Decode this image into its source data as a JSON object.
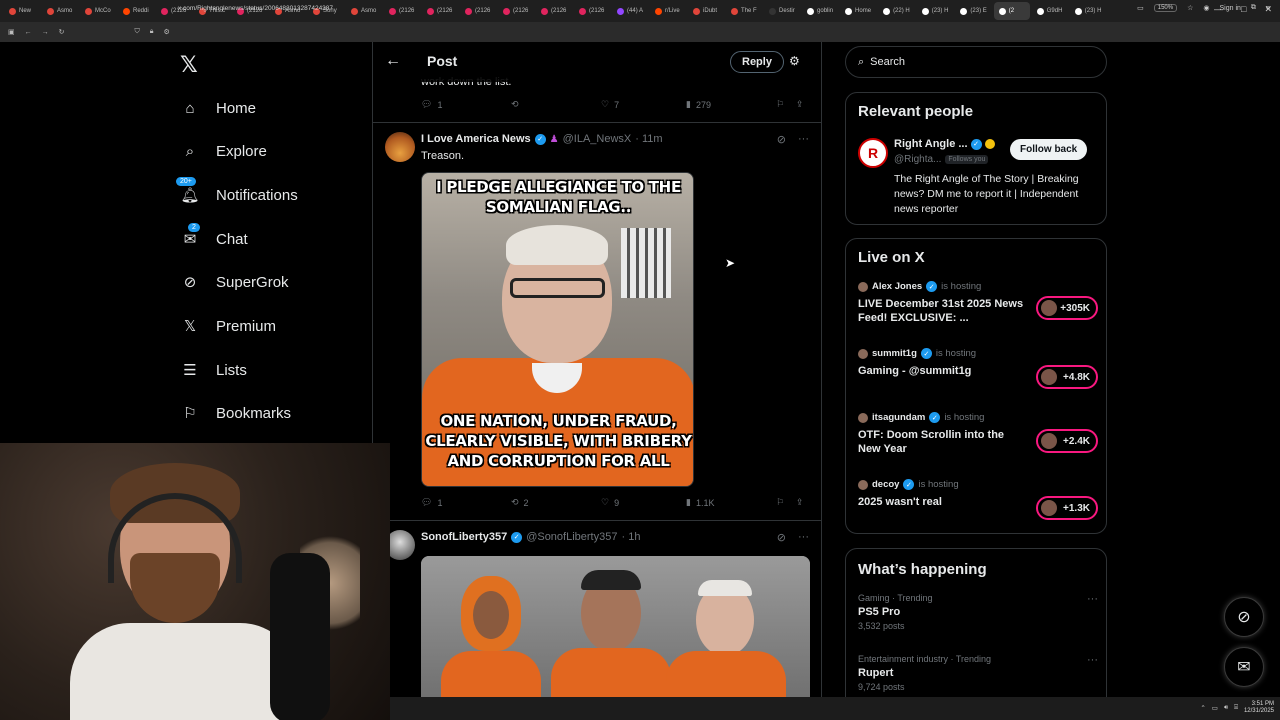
{
  "browser": {
    "tabs": [
      {
        "label": "New",
        "color": "#e0453a"
      },
      {
        "label": "Asmo",
        "color": "#e0453a"
      },
      {
        "label": "McCo",
        "color": "#e0453a"
      },
      {
        "label": "Reddi",
        "color": "#ff4500"
      },
      {
        "label": "(2126",
        "color": "#e0245e"
      },
      {
        "label": "This c",
        "color": "#e0453a"
      },
      {
        "label": "(2126",
        "color": "#e0245e"
      },
      {
        "label": "Asmo",
        "color": "#e0453a"
      },
      {
        "label": "Sony",
        "color": "#e0453a"
      },
      {
        "label": "Asmo",
        "color": "#e0453a"
      },
      {
        "label": "(2126",
        "color": "#e0245e"
      },
      {
        "label": "(2126",
        "color": "#e0245e"
      },
      {
        "label": "(2126",
        "color": "#e0245e"
      },
      {
        "label": "(2126",
        "color": "#e0245e"
      },
      {
        "label": "(2126",
        "color": "#e0245e"
      },
      {
        "label": "(2126",
        "color": "#e0245e"
      },
      {
        "label": "(44) A",
        "color": "#9146ff"
      },
      {
        "label": "r/Live",
        "color": "#ff4500"
      },
      {
        "label": "iDubt",
        "color": "#e0453a"
      },
      {
        "label": "The F",
        "color": "#e0453a"
      },
      {
        "label": "Destir",
        "color": "#333"
      },
      {
        "label": "goblin",
        "color": "#fff"
      },
      {
        "label": "Home",
        "color": "#fff"
      },
      {
        "label": "(22) H",
        "color": "#fff"
      },
      {
        "label": "(23) H",
        "color": "#fff"
      },
      {
        "label": "(23) E",
        "color": "#fff"
      },
      {
        "label": "(2",
        "color": "#fff",
        "active": true
      },
      {
        "label": "G9dH",
        "color": "#fff"
      },
      {
        "label": "(23) H",
        "color": "#fff"
      }
    ],
    "url": "x.com/Rightanglenews/status/2006483013287424387",
    "zoom": "150%",
    "sign_in": "Sign in"
  },
  "nav": {
    "logo": "𝕏",
    "items": [
      {
        "label": "Home",
        "icon": "home-icon"
      },
      {
        "label": "Explore",
        "icon": "search-icon"
      },
      {
        "label": "Notifications",
        "icon": "bell-icon",
        "badge": "20+"
      },
      {
        "label": "Chat",
        "icon": "mail-icon",
        "badge": "2"
      },
      {
        "label": "SuperGrok",
        "icon": "grok-icon"
      },
      {
        "label": "Premium",
        "icon": "x-premium-icon"
      },
      {
        "label": "Lists",
        "icon": "list-icon"
      },
      {
        "label": "Bookmarks",
        "icon": "bookmark-icon"
      }
    ]
  },
  "header": {
    "title": "Post",
    "reply": "Reply"
  },
  "prev_tweet": {
    "tail": "work down the list.",
    "replies": "1",
    "reposts": "",
    "likes": "7",
    "views": "279"
  },
  "tweet1": {
    "name": "I Love America News",
    "handle": "@ILA_NewsX",
    "time": "· 11m",
    "text": "Treason.",
    "meme_top": "I PLEDGE ALLEGIANCE TO THE SOMALIAN FLAG..",
    "meme_bottom": "ONE NATION, UNDER FRAUD, CLEARLY VISIBLE, WITH BRIBERY AND CORRUPTION FOR ALL",
    "replies": "1",
    "reposts": "2",
    "likes": "9",
    "views": "1.1K"
  },
  "tweet2": {
    "name": "SonofLiberty357",
    "handle": "@SonofLiberty357",
    "time": "· 1h"
  },
  "search": {
    "placeholder": "Search"
  },
  "relevant": {
    "title": "Relevant people",
    "name": "Right Angle ...",
    "handle": "@Righta...",
    "follows_you": "Follows you",
    "follow_back": "Follow back",
    "bio": "The Right Angle of The Story | Breaking news? DM me to report it | Independent news reporter",
    "avatar_letter": "R"
  },
  "live": {
    "title": "Live on X",
    "hosting_label": "is hosting",
    "items": [
      {
        "host": "Alex Jones",
        "title": "LIVE December 31st 2025 News Feed! EXCLUSIVE: ...",
        "count": "+305K"
      },
      {
        "host": "summit1g",
        "title": "Gaming - @summit1g",
        "count": "+4.8K"
      },
      {
        "host": "itsagundam",
        "title": "OTF: Doom Scrollin into the New Year",
        "count": "+2.4K"
      },
      {
        "host": "decoy",
        "title": "2025 wasn't real",
        "count": "+1.3K"
      }
    ]
  },
  "trending": {
    "title": "What’s happening",
    "items": [
      {
        "meta": "Gaming · Trending",
        "name": "PS5 Pro",
        "count": "3,532 posts"
      },
      {
        "meta": "Entertainment industry · Trending",
        "name": "Rupert",
        "count": "9,724 posts"
      }
    ]
  },
  "clock": {
    "time": "3:51 PM",
    "date": "12/31/2025"
  }
}
